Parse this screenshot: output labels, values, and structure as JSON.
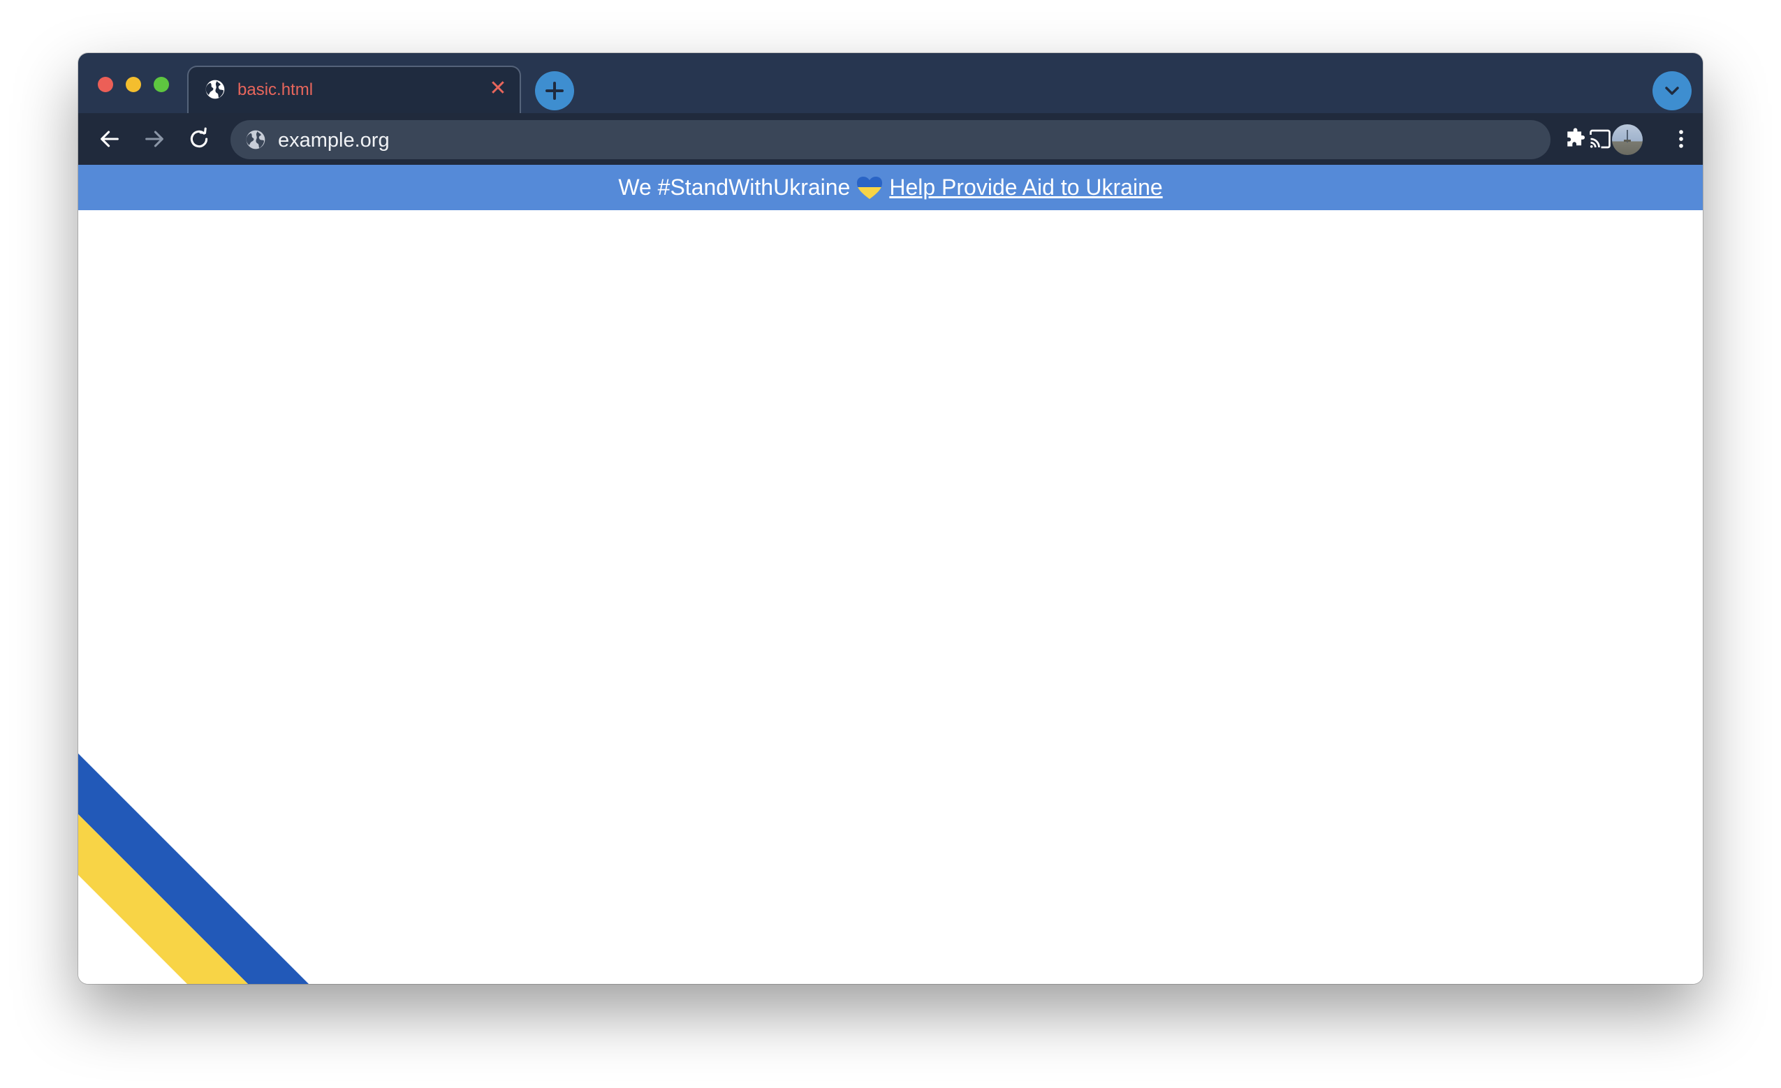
{
  "window": {
    "traffic_lights": [
      "close",
      "minimize",
      "zoom"
    ]
  },
  "tabs": [
    {
      "title": "basic.html",
      "icon": "globe-icon",
      "close_glyph": "✕"
    }
  ],
  "toolbar": {
    "url": "example.org"
  },
  "banner": {
    "text": "We #StandWithUkraine",
    "link_text": "Help Provide Aid to Ukraine",
    "heart_colors": [
      "#2a64c5",
      "#f8d446"
    ]
  },
  "ribbon": {
    "colors": [
      "#2259b8",
      "#f8d446"
    ]
  },
  "colors": {
    "titlebar": "#273650",
    "toolbar": "#202a3c",
    "omnibox": "#3a4658",
    "accent": "#3e8ed0",
    "tab_title": "#e8665c",
    "banner_bg": "#558ad8"
  }
}
